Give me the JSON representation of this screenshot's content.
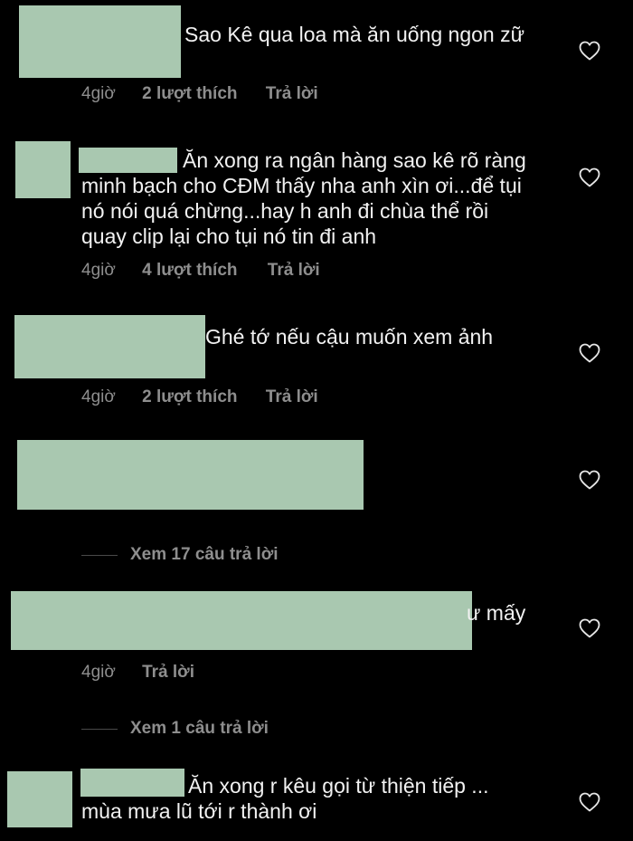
{
  "colors": {
    "background": "#000000",
    "text": "#f2f2f2",
    "meta": "#8e8e8e",
    "redaction": "#a9c8b0"
  },
  "comments": [
    {
      "text": "Sao Kê qua loa mà ăn uống ngon zữ",
      "time": "4giờ",
      "likes": "2 lượt thích",
      "reply": "Trả lời"
    },
    {
      "lines": [
        "Ăn xong ra ngân hàng sao kê rõ ràng",
        "minh bạch cho CĐM thấy nha anh xìn ơi...để tụi",
        "nó nói quá chừng...hay h anh đi chùa thể rồi",
        "quay clip lại cho tụi nó tin đi anh"
      ],
      "time": "4giờ",
      "likes": "4 lượt thích",
      "reply": "Trả lời"
    },
    {
      "text": "Ghé tớ nếu cậu muốn xem ảnh",
      "time": "4giờ",
      "likes": "2 lượt thích",
      "reply": "Trả lời"
    },
    {
      "view_replies": "Xem 17 câu trả lời"
    },
    {
      "text": "ư mấy",
      "time": "4giờ",
      "reply": "Trả lời",
      "view_replies": "Xem 1 câu trả lời"
    },
    {
      "lines": [
        "Ăn xong r kêu gọi từ thiện tiếp ...",
        "mùa mưa lũ tới r thành ơi"
      ]
    }
  ],
  "icons": {
    "like": "heart-outline-icon"
  }
}
